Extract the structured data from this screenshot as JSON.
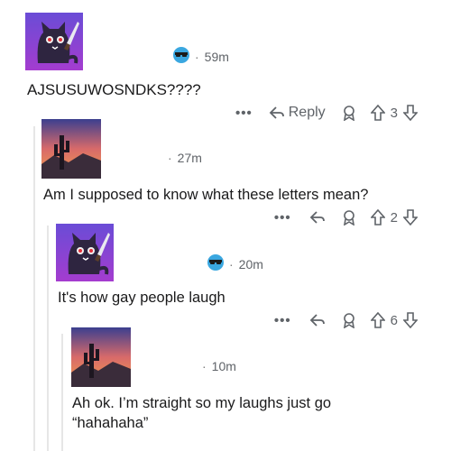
{
  "comments": [
    {
      "time": "59m",
      "dot": "·",
      "text": "AJSUSUWOSNDKS????",
      "actions": {
        "more": "•••",
        "reply": "Reply",
        "votes": "3"
      }
    },
    {
      "time": "27m",
      "dot": "·",
      "text": "Am I supposed to know what these letters mean?",
      "actions": {
        "more": "•••",
        "votes": "2"
      }
    },
    {
      "time": "20m",
      "dot": "·",
      "text": "It's how gay people laugh",
      "actions": {
        "more": "•••",
        "votes": "6"
      }
    },
    {
      "time": "10m",
      "dot": "·",
      "text": "Ah ok. I’m straight so my laughs just go",
      "text2": "“hahahaha”"
    }
  ],
  "colors": {
    "meta_gray": "#5f6368",
    "thread_line": "#e6e6e6",
    "text": "#1a1a1b"
  },
  "icons": [
    "cat-knife-avatar",
    "desert-sunset-avatar",
    "sunglasses-badge-icon",
    "reply-arrow-icon",
    "award-icon",
    "upvote-icon",
    "downvote-icon",
    "more-icon"
  ]
}
